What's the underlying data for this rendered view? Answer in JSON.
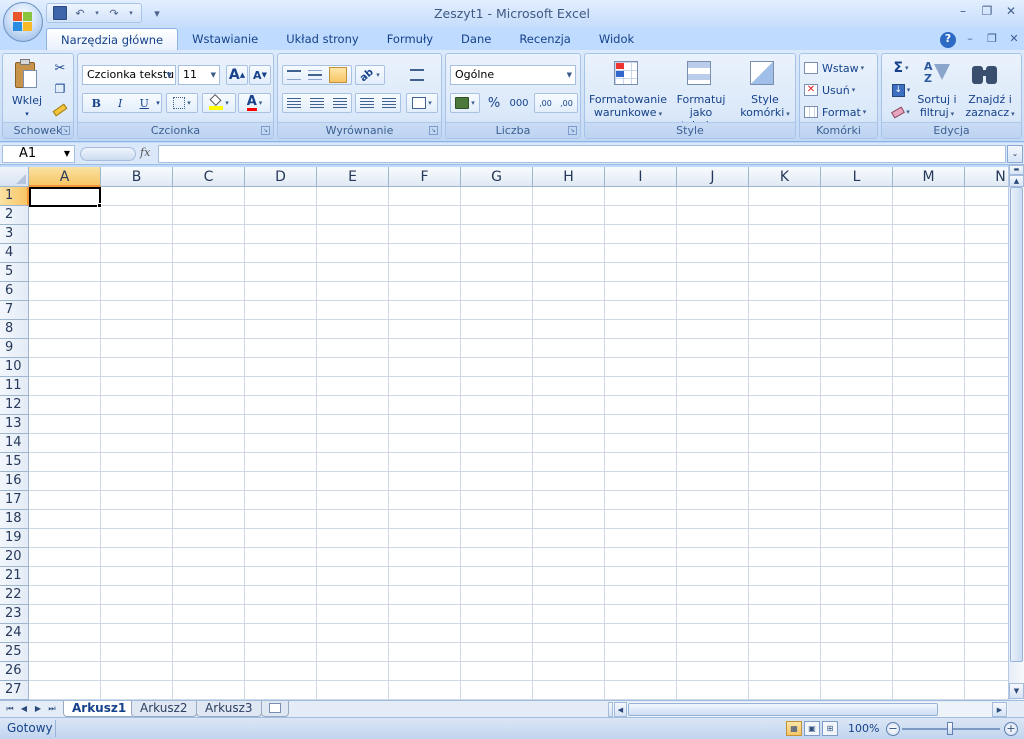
{
  "window": {
    "title": "Zeszyt1 - Microsoft Excel",
    "controls": {
      "minimize": "–",
      "restore": "❐",
      "close": "✕"
    },
    "doc_controls": {
      "minimize": "–",
      "restore": "❐",
      "close": "✕"
    },
    "help": "?"
  },
  "quick_access": {
    "save": "💾",
    "undo": "↶",
    "redo": "↷",
    "customize": "▾"
  },
  "ribbon_tabs": [
    {
      "label": "Narzędzia główne",
      "active": true
    },
    {
      "label": "Wstawianie"
    },
    {
      "label": "Układ strony"
    },
    {
      "label": "Formuły"
    },
    {
      "label": "Dane"
    },
    {
      "label": "Recenzja"
    },
    {
      "label": "Widok"
    }
  ],
  "groups": {
    "clipboard": {
      "label": "Schowek",
      "paste": "Wklej",
      "cut_icon": "✂",
      "copy_icon": "❐",
      "painter_icon": "🖌"
    },
    "font": {
      "label": "Czcionka",
      "font_name": "Czcionka tekstu",
      "font_size": "11",
      "grow": "A",
      "shrink": "A",
      "bold": "B",
      "italic": "I",
      "underline": "U",
      "fill_color": "#ffff00",
      "font_color": "#ff0000",
      "font_color_glyph": "A"
    },
    "alignment": {
      "label": "Wyrównanie"
    },
    "number": {
      "label": "Liczba",
      "format": "Ogólne",
      "percent": "%",
      "thousands": "000",
      "inc_decimal": ",00",
      "dec_decimal": ",00"
    },
    "styles": {
      "label": "Style",
      "conditional_line1": "Formatowanie",
      "conditional_line2": "warunkowe",
      "table_line1": "Formatuj",
      "table_line2": "jako tabelę",
      "cell_line1": "Style",
      "cell_line2": "komórki"
    },
    "cells": {
      "label": "Komórki",
      "insert": "Wstaw",
      "delete": "Usuń",
      "format": "Format"
    },
    "editing": {
      "label": "Edycja",
      "sum": "Σ",
      "sort_line1": "Sortuj i",
      "sort_line2": "filtruj",
      "find_line1": "Znajdź i",
      "find_line2": "zaznacz"
    }
  },
  "formula_bar": {
    "name_box": "A1",
    "fx": "fx",
    "formula": ""
  },
  "grid": {
    "columns": [
      "A",
      "B",
      "C",
      "D",
      "E",
      "F",
      "G",
      "H",
      "I",
      "J",
      "K",
      "L",
      "M",
      "N"
    ],
    "rows": [
      "1",
      "2",
      "3",
      "4",
      "5",
      "6",
      "7",
      "8",
      "9",
      "10",
      "11",
      "12",
      "13",
      "14",
      "15",
      "16",
      "17",
      "18",
      "19",
      "20",
      "21",
      "22",
      "23",
      "24",
      "25",
      "26",
      "27"
    ],
    "active_column": "A",
    "active_row": "1"
  },
  "sheets": [
    {
      "label": "Arkusz1",
      "active": true
    },
    {
      "label": "Arkusz2"
    },
    {
      "label": "Arkusz3"
    }
  ],
  "status": {
    "text": "Gotowy",
    "zoom": "100%"
  },
  "colors": {
    "ribbon_text": "#15428b",
    "selection_header": "#f7c565",
    "grid_line": "#d0d7e5"
  }
}
